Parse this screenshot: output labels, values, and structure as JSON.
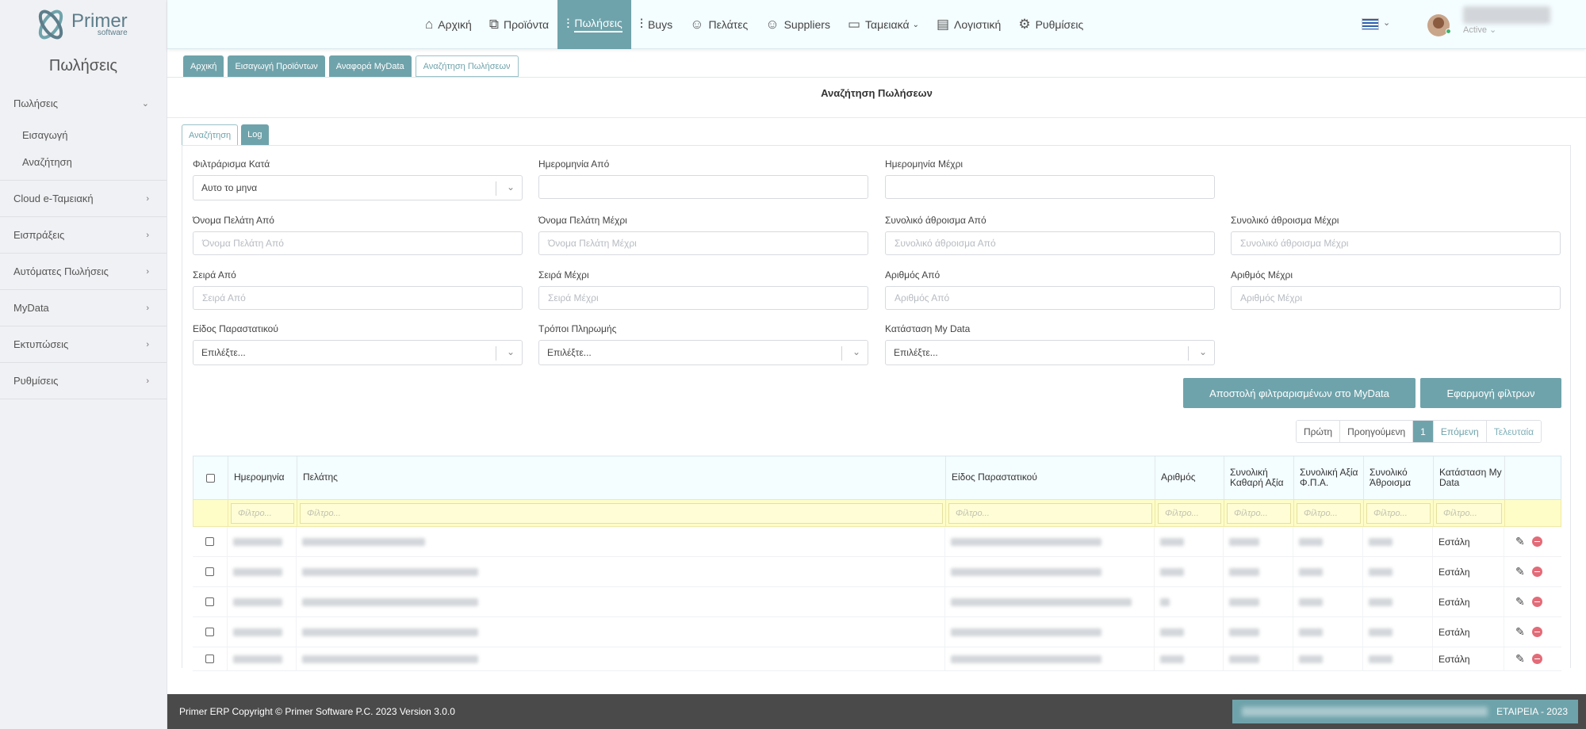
{
  "logo": {
    "name": "Primer",
    "sub": "software"
  },
  "sidebar": {
    "title": "Πωλήσεις",
    "items": [
      {
        "label": "Πωλήσεις",
        "open": true,
        "sub": [
          "Εισαγωγή",
          "Αναζήτηση"
        ]
      },
      {
        "label": "Cloud e-Ταμειακή"
      },
      {
        "label": "Εισπράξεις"
      },
      {
        "label": "Αυτόματες Πωλήσεις"
      },
      {
        "label": "MyData"
      },
      {
        "label": "Εκτυπώσεις"
      },
      {
        "label": "Ρυθμίσεις"
      }
    ]
  },
  "nav": {
    "items": [
      {
        "label": "Αρχική",
        "icon": "home-icon"
      },
      {
        "label": "Προϊόντα",
        "icon": "products-icon"
      },
      {
        "label": "Πωλήσεις",
        "icon": "sales-chart-icon",
        "active": true
      },
      {
        "label": "Buys",
        "icon": "buys-chart-icon"
      },
      {
        "label": "Πελάτες",
        "icon": "customer-icon"
      },
      {
        "label": "Suppliers",
        "icon": "supplier-icon"
      },
      {
        "label": "Ταμειακά",
        "icon": "cash-register-icon",
        "dropdown": true
      },
      {
        "label": "Λογιστική",
        "icon": "accounting-icon"
      },
      {
        "label": "Ρυθμίσεις",
        "icon": "gear-icon"
      }
    ],
    "user_status": "Active"
  },
  "page_tabs": [
    "Αρχική",
    "Εισαγωγή Προϊόντων",
    "Αναφορά MyData",
    "Αναζήτηση Πωλήσεων"
  ],
  "page_heading": "Αναζήτηση Πωλήσεων",
  "inner_tabs": [
    "Αναζήτηση",
    "Log"
  ],
  "form": {
    "filter_by": {
      "label": "Φιλτράρισμα Κατά",
      "value": "Αυτο το μηνα"
    },
    "date_from": {
      "label": "Ημερομηνία Από"
    },
    "date_to": {
      "label": "Ημερομηνία Μέχρι"
    },
    "customer_from": {
      "label": "Όνομα Πελάτη Από",
      "placeholder": "Όνομα Πελάτη Από"
    },
    "customer_to": {
      "label": "Όνομα Πελάτη Μέχρι",
      "placeholder": "Όνομα Πελάτη Μέχρι"
    },
    "total_from": {
      "label": "Συνολικό άθροισμα Από",
      "placeholder": "Συνολικό άθροισμα Από"
    },
    "total_to": {
      "label": "Συνολικό άθροισμα Μέχρι",
      "placeholder": "Συνολικό άθροισμα Μέχρι"
    },
    "series_from": {
      "label": "Σειρά Από",
      "placeholder": "Σειρά Από"
    },
    "series_to": {
      "label": "Σειρά Μέχρι",
      "placeholder": "Σειρά Μέχρι"
    },
    "number_from": {
      "label": "Αριθμός Από",
      "placeholder": "Αριθμός Από"
    },
    "number_to": {
      "label": "Αριθμός Μέχρι",
      "placeholder": "Αριθμός Μέχρι"
    },
    "doc_type": {
      "label": "Είδος Παραστατικού",
      "value": "Επιλέξτε..."
    },
    "payment": {
      "label": "Τρόποι Πληρωμής",
      "value": "Επιλέξτε..."
    },
    "mydata_status": {
      "label": "Κατάσταση My Data",
      "value": "Επιλέξτε..."
    }
  },
  "buttons": {
    "send_mydata": "Αποστολή φιλτραρισμένων στο MyData",
    "apply_filters": "Εφαρμογή φίλτρων"
  },
  "pager": {
    "first": "Πρώτη",
    "prev": "Προηγούμενη",
    "current": "1",
    "next": "Επόμενη",
    "last": "Τελευταία"
  },
  "table": {
    "headers": [
      "Ημερομηνία",
      "Πελάτης",
      "Είδος Παραστατικού",
      "Αριθμός",
      "Συνολική Καθαρή Αξία",
      "Συνολική Αξία Φ.Π.Α.",
      "Συνολικό Άθροισμα",
      "Κατάσταση My Data"
    ],
    "filter_placeholder": "Φίλτρο...",
    "rows": [
      {
        "status": "Εστάλη"
      },
      {
        "status": "Εστάλη"
      },
      {
        "status": "Εστάλη"
      },
      {
        "status": "Εστάλη"
      },
      {
        "status": "Εστάλη"
      }
    ]
  },
  "footer": {
    "copyright": "Primer ERP Copyright © Primer Software P.C. 2023 Version 3.0.0",
    "company": "ΕΤΑΙΡΕΙΑ - 2023"
  },
  "colors": {
    "accent": "#6fa3ab",
    "filter_row": "#fefdc8",
    "delete": "#e36b78",
    "footer": "#4a4a4a"
  }
}
